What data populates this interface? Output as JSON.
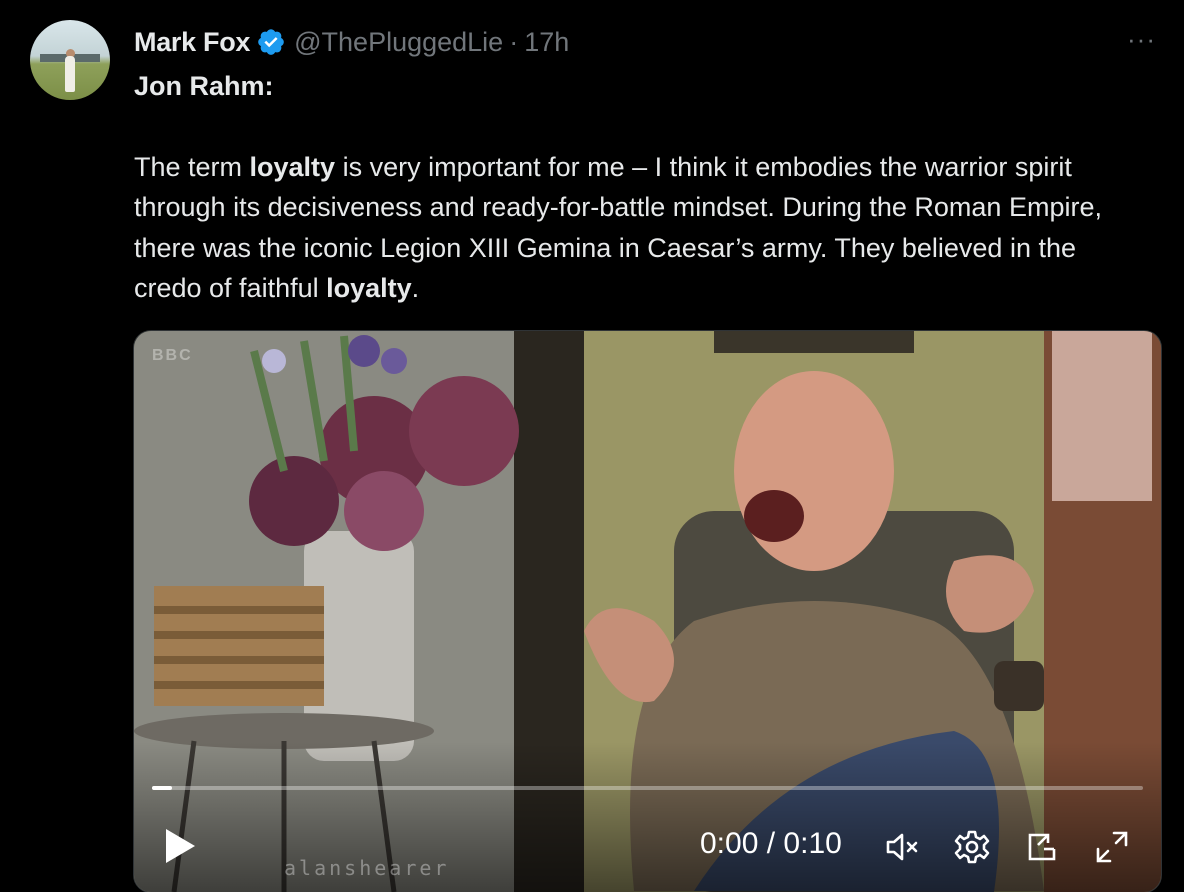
{
  "author": {
    "name": "Mark Fox",
    "handle": "@ThePluggedLie",
    "separator": "·",
    "time": "17h",
    "verified_color": "#1d9bf0",
    "verified_icon": "verified-badge-icon"
  },
  "more_icon": "···",
  "tweet": {
    "line1": "Jon Rahm:",
    "p_start": "The term ",
    "bold1": "loyalty",
    "p_mid": " is very important for me – I think it embodies the warrior spirit through its decisiveness and ready-for-battle mindset. During the Roman Empire, there was the iconic Legion XIII Gemina in Caesar’s army. They believed in the credo of faithful ",
    "bold2": "loyalty",
    "p_end": "."
  },
  "video": {
    "progress": 0.02,
    "current_time": "0:00",
    "time_separator": "/",
    "duration": "0:10",
    "watermark": "alanshearer",
    "channel_logo": "BBC",
    "controls": [
      "play-icon",
      "muted-speaker-icon",
      "settings-gear-icon",
      "pip-icon",
      "fullscreen-icon"
    ]
  }
}
